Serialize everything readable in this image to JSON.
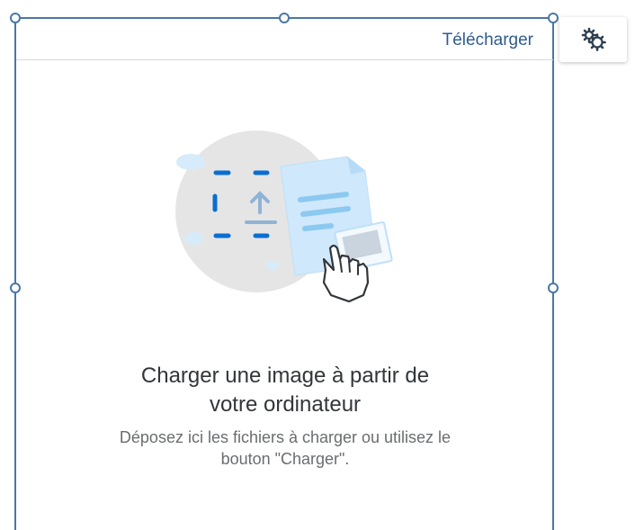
{
  "toolbar": {
    "download_label": "Télécharger"
  },
  "settings": {
    "icon": "gears-icon"
  },
  "upload": {
    "title_line1": "Charger une image à partir de",
    "title_line2": "votre ordinateur",
    "hint_line1": "Déposez ici les fichiers à charger ou utilisez le",
    "hint_line2": "bouton \"Charger\"."
  },
  "colors": {
    "frame": "#4a77a6",
    "link": "#2f5b8d",
    "accent": "#0a6ed1"
  }
}
